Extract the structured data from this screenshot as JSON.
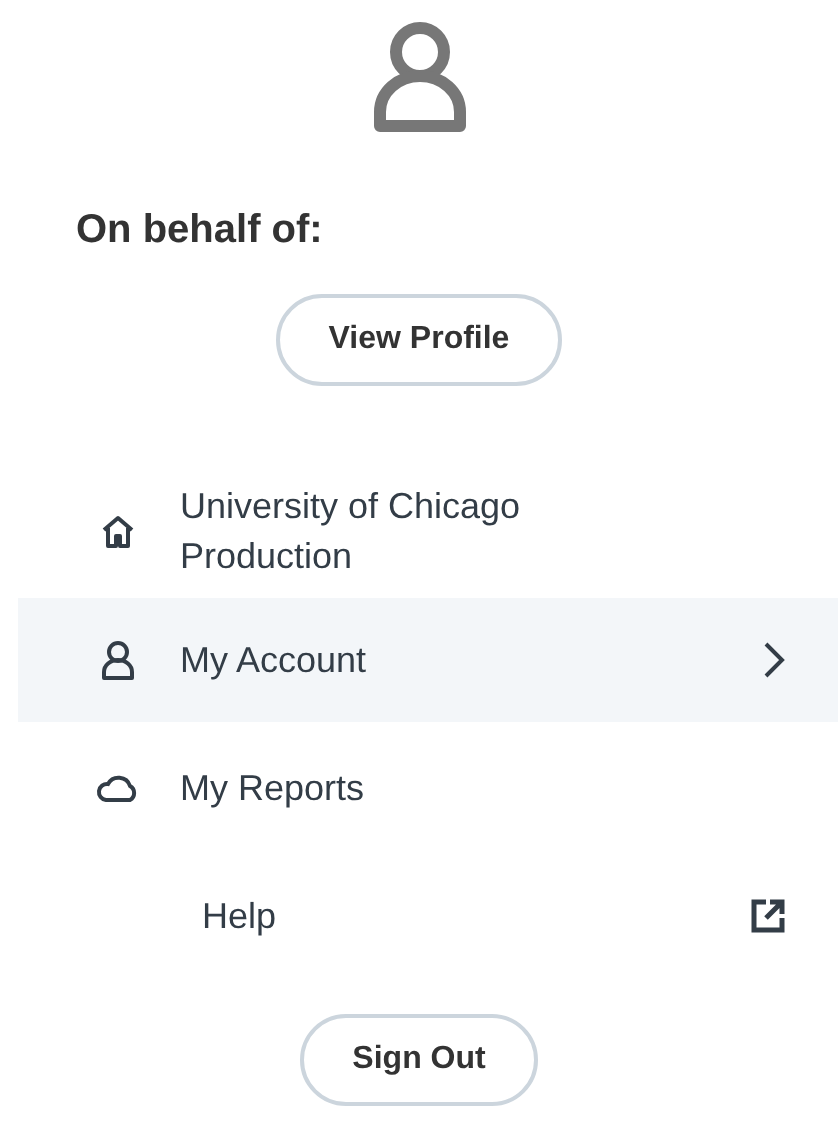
{
  "header": {
    "label": "On behalf of:",
    "button": "View Profile"
  },
  "menu": [
    {
      "kind": "home",
      "label": "University of Chicago Production",
      "selected": false
    },
    {
      "kind": "account",
      "label": "My Account",
      "selected": true
    },
    {
      "kind": "cloud",
      "label": "My Reports",
      "selected": false
    },
    {
      "kind": "external",
      "label": "Help",
      "selected": false
    }
  ],
  "footer": {
    "button": "Sign Out"
  }
}
